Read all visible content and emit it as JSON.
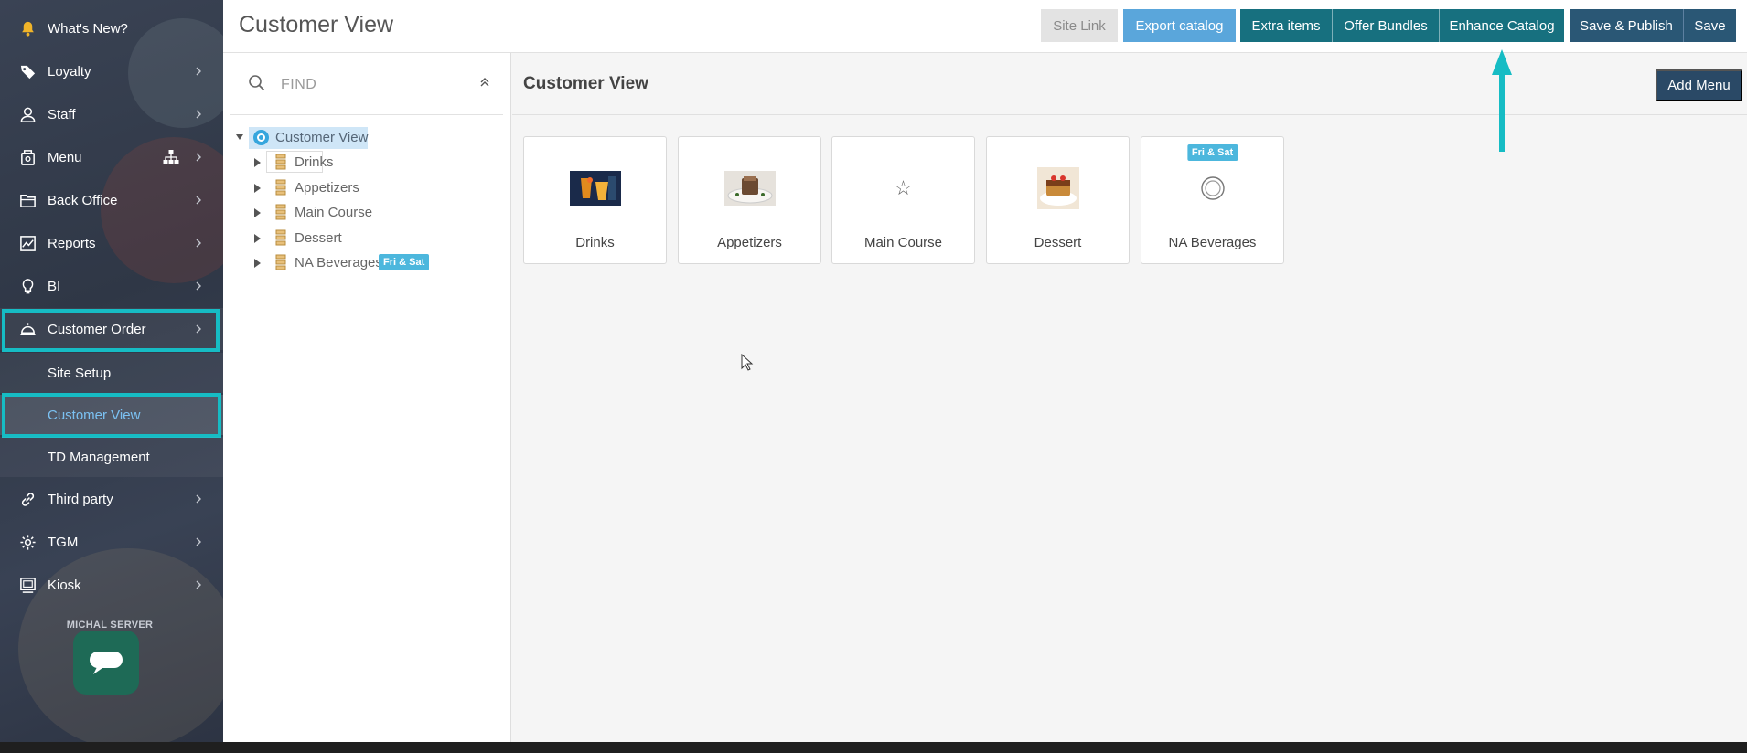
{
  "sidebar": {
    "items": [
      {
        "label": "What's New?",
        "icon": "bell-icon"
      },
      {
        "label": "Loyalty",
        "icon": "tag-icon"
      },
      {
        "label": "Staff",
        "icon": "user-icon"
      },
      {
        "label": "Menu",
        "icon": "menu-book-icon"
      },
      {
        "label": "Back Office",
        "icon": "folder-icon"
      },
      {
        "label": "Reports",
        "icon": "chart-icon"
      },
      {
        "label": "BI",
        "icon": "lightbulb-icon"
      },
      {
        "label": "Customer Order",
        "icon": "cloche-icon"
      },
      {
        "label": "Third party",
        "icon": "link-icon"
      },
      {
        "label": "TGM",
        "icon": "gear-icon"
      },
      {
        "label": "Kiosk",
        "icon": "kiosk-icon"
      }
    ],
    "sub_items": [
      {
        "label": "Site Setup"
      },
      {
        "label": "Customer View"
      },
      {
        "label": "TD Management"
      }
    ],
    "server_label": "MICHAL SERVER"
  },
  "header": {
    "title": "Customer View",
    "buttons": {
      "site_link": "Site Link",
      "export_catalog": "Export catalog",
      "extra_items": "Extra items",
      "offer_bundles": "Offer Bundles",
      "enhance_catalog": "Enhance Catalog",
      "save_publish": "Save & Publish",
      "save": "Save"
    }
  },
  "tree": {
    "search_placeholder": "FIND",
    "root": "Customer View",
    "children": [
      {
        "label": "Drinks"
      },
      {
        "label": "Appetizers"
      },
      {
        "label": "Main Course"
      },
      {
        "label": "Dessert"
      },
      {
        "label": "NA Beverages",
        "badge": "Fri & Sat"
      }
    ]
  },
  "main": {
    "title": "Customer View",
    "add_menu": "Add Menu",
    "cards": [
      {
        "name": "Drinks",
        "thumb": "drinks-photo"
      },
      {
        "name": "Appetizers",
        "thumb": "appetizers-photo"
      },
      {
        "name": "Main Course",
        "thumb": "star-icon",
        "glyph": "☆"
      },
      {
        "name": "Dessert",
        "thumb": "dessert-photo"
      },
      {
        "name": "NA Beverages",
        "thumb": "circle-icon",
        "badge": "Fri & Sat"
      }
    ]
  },
  "colors": {
    "sidebar_bg": "#343c4b",
    "highlight": "#16bcc4",
    "active_sub": "#7bc1f2",
    "teal_button": "#17707f",
    "navy_button": "#2a5775",
    "light_blue_button": "#5aa6db",
    "badge": "#4cb7dd",
    "annotation_arrow": "#16bcc4"
  }
}
